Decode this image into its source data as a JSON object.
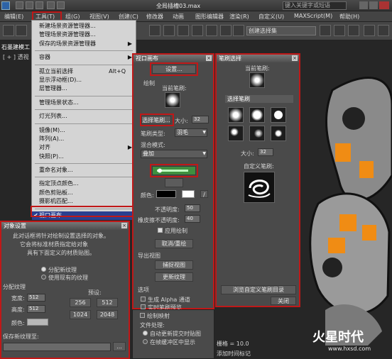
{
  "window": {
    "title": "全局插槽03.max",
    "search_placeholder": "键入关键字或短语"
  },
  "menubar": [
    "编辑(E)",
    "工具(T)",
    "组(G)",
    "视图(V)",
    "创建(C)",
    "修改器",
    "动画",
    "图形编辑器",
    "渲染(R)",
    "自定义(U)",
    "MAXScript(M)",
    "帮助(H)"
  ],
  "toolbar": {
    "selection_set": "创建选择集"
  },
  "viewport": {
    "label": "[ + ] 透视",
    "tab": "石墨建模工"
  },
  "tools_menu": {
    "items": [
      {
        "label": "新建场景资源管理器...",
        "shortcut": "",
        "arrow": ""
      },
      {
        "label": "管理场景资源管理器...",
        "shortcut": "",
        "arrow": ""
      },
      {
        "label": "保存的场景资源管理器",
        "shortcut": "",
        "arrow": "▶"
      },
      {
        "label": "容器",
        "shortcut": "",
        "arrow": "▶",
        "sep": true
      },
      {
        "label": "孤立当前选择",
        "shortcut": "Alt+Q",
        "arrow": "",
        "sep": true
      },
      {
        "label": "显示浮动框(D)...",
        "shortcut": "",
        "arrow": ""
      },
      {
        "label": "层管理器...",
        "shortcut": "",
        "arrow": ""
      },
      {
        "label": "管理场景状态...",
        "shortcut": "",
        "arrow": "",
        "sep": true
      },
      {
        "label": "灯光列表...",
        "shortcut": "",
        "arrow": "",
        "sep": true
      },
      {
        "label": "镜像(M)...",
        "shortcut": "",
        "arrow": "",
        "sep": true
      },
      {
        "label": "阵列(A)...",
        "shortcut": "",
        "arrow": ""
      },
      {
        "label": "对齐",
        "shortcut": "",
        "arrow": "▶"
      },
      {
        "label": "快照(P)...",
        "shortcut": "",
        "arrow": ""
      },
      {
        "label": "重命名对象...",
        "shortcut": "",
        "arrow": "",
        "sep": true
      },
      {
        "label": "指定顶点颜色...",
        "shortcut": "",
        "arrow": "",
        "sep": true
      },
      {
        "label": "颜色剪贴板...",
        "shortcut": "",
        "arrow": ""
      },
      {
        "label": "摄影机匹配...",
        "shortcut": "",
        "arrow": ""
      },
      {
        "label": "视口画布...",
        "shortcut": "",
        "arrow": "",
        "sep": true,
        "checked": true,
        "highlight": true
      }
    ]
  },
  "canvas_panel": {
    "title": "视口画布",
    "settings": "设置...",
    "paint_section": "绘制",
    "current_brush": "当前笔刷:",
    "select_brush": "选择笔刷...",
    "size_label": "大小:",
    "size": "32",
    "brush_type_label": "笔刷类型:",
    "brush_type": "羽毛",
    "blend_label": "混合模式:",
    "blend_mode": "叠加",
    "color_label": "颜色:",
    "opacity_label": "不透明度:",
    "opacity": "50",
    "eraser_label": "橡皮擦不透明度:",
    "eraser": "40",
    "apply": "应用绘制",
    "cancel": "取消/重绘",
    "export_section": "导出视图",
    "capture": "捕捉视图",
    "update": "更新纹理",
    "options_section": "选项",
    "opt1": "生成 Alpha 通道",
    "opt2": "实时笔刷预览",
    "opt3": "绘制映射",
    "file_label": "文件处理:",
    "file_opt1": "自动更新提交时贴图",
    "file_opt2": "在帧缓冲区中显示"
  },
  "brush_panel": {
    "title": "笔刷选择",
    "current_brush": "当前笔刷:",
    "select_section": "选择笔刷",
    "size_label": "大小:",
    "size": "32",
    "custom_label": "自定义笔刷:",
    "browse": "浏览自定义笔刷目录",
    "close": "关闭"
  },
  "object_settings": {
    "title": "对象设置",
    "desc1": "此对话框将针对绘制设置选择的对象。",
    "desc2": "它会将标准材质指定给对象",
    "desc3": "具有下面定义的材质贴图。",
    "radio1": "分配新纹理",
    "radio2": "使用现有的纹理",
    "assign_texture": "分配纹理",
    "width_label": "宽度:",
    "width": "512",
    "height_label": "高度:",
    "height": "512",
    "presets_label": "预设:",
    "p256": "256",
    "p512": "512",
    "p1024": "1024",
    "p2048": "2048",
    "color_label": "颜色:",
    "save_label": "保存新纹理至:",
    "browse_btn": "..."
  },
  "status": {
    "grid": "栅格 = 10.0",
    "add_time_tag": "添加时间标记"
  },
  "watermark": {
    "brand": "火星时代",
    "url": "www.hxsd.com"
  }
}
